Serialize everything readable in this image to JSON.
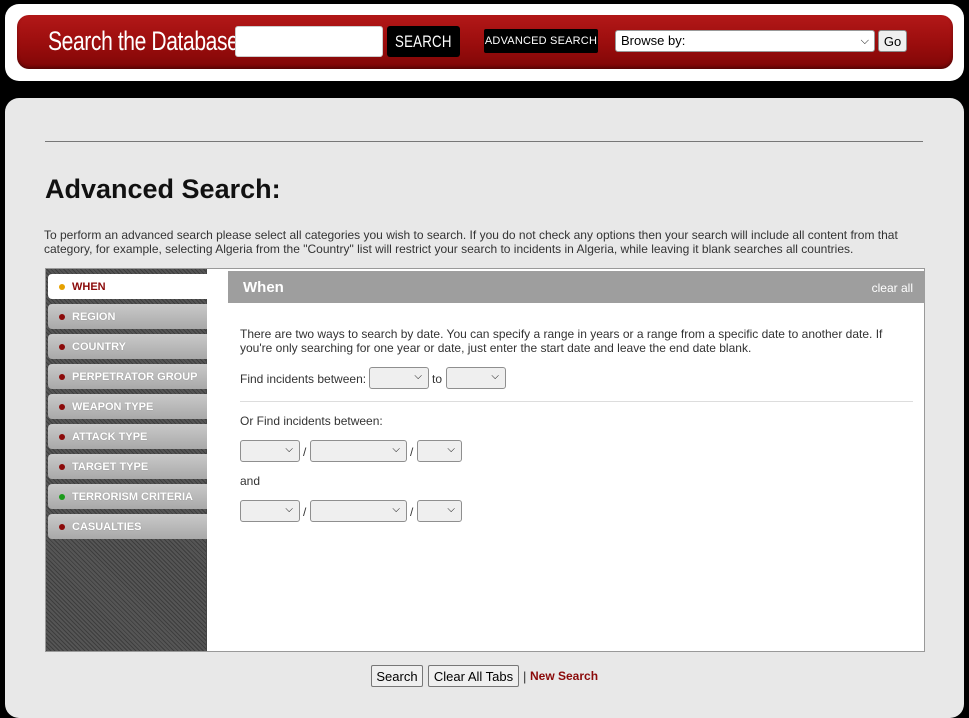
{
  "header": {
    "site_title": "Search the Database",
    "search_button": "SEARCH",
    "advanced_button": "ADVANCED SEARCH",
    "browse_select": "Browse by:",
    "go_button": "Go"
  },
  "page": {
    "title": "Advanced Search:",
    "intro": "To perform an advanced search please select all categories you wish to search. If you do not check any options then your search will include all content from that category, for example, selecting Algeria from the \"Country\" list will restrict your search to incidents in Algeria, while leaving it blank searches all countries."
  },
  "sidebar": {
    "tabs": [
      {
        "label": "WHEN",
        "dot_color": "#e6a100"
      },
      {
        "label": "REGION",
        "dot_color": "#8b0a0a"
      },
      {
        "label": "COUNTRY",
        "dot_color": "#8b0a0a"
      },
      {
        "label": "PERPETRATOR GROUP",
        "dot_color": "#8b0a0a"
      },
      {
        "label": "WEAPON TYPE",
        "dot_color": "#8b0a0a"
      },
      {
        "label": "ATTACK TYPE",
        "dot_color": "#8b0a0a"
      },
      {
        "label": "TARGET TYPE",
        "dot_color": "#8b0a0a"
      },
      {
        "label": "TERRORISM CRITERIA",
        "dot_color": "#1a9a1a"
      },
      {
        "label": "CASUALTIES",
        "dot_color": "#8b0a0a"
      }
    ]
  },
  "pane": {
    "title": "When",
    "clear_all": "clear all",
    "description": "There are two ways to search by date. You can specify a range in years or a range from a specific date to another date. If you're only searching for one year or date, just enter the start date and leave the end date blank.",
    "find_between": "Find incidents between:",
    "to": "to",
    "or_find_between": "Or Find incidents between:",
    "and": "and",
    "slash": "/"
  },
  "footer": {
    "search_button": "Search",
    "clear_tabs_button": "Clear All Tabs",
    "separator": "|",
    "new_search_link": "New Search"
  },
  "colors": {
    "brand_red": "#9a0d0d",
    "accent_link": "#8b0a0a"
  }
}
